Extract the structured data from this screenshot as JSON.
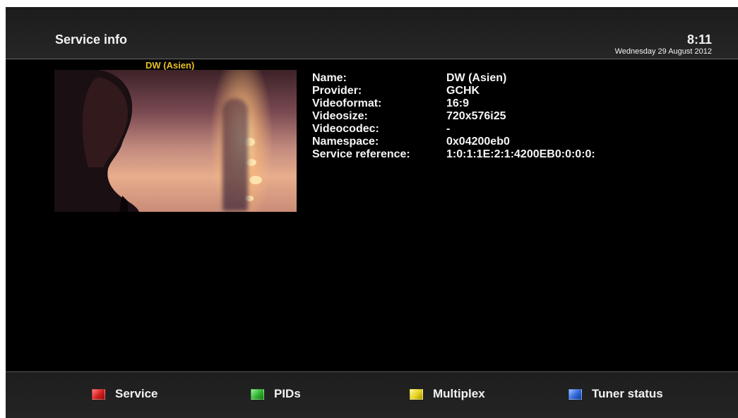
{
  "header": {
    "title": "Service info",
    "time": "8:11",
    "date": "Wednesday 29 August 2012"
  },
  "preview": {
    "channel_label": "DW (Asien)"
  },
  "info": {
    "rows": [
      {
        "key": "Name:",
        "value": "DW (Asien)"
      },
      {
        "key": "Provider:",
        "value": "GCHK"
      },
      {
        "key": "Videoformat:",
        "value": "16:9"
      },
      {
        "key": "Videosize:",
        "value": "720x576i25"
      },
      {
        "key": "Videocodec:",
        "value": "-"
      },
      {
        "key": "Namespace:",
        "value": "0x04200eb0"
      },
      {
        "key": "Service reference:",
        "value": "1:0:1:1E:2:1:4200EB0:0:0:0:"
      }
    ]
  },
  "footer": {
    "buttons": [
      {
        "label": "Service",
        "color": "#d41e1e",
        "icon": "red-key-icon"
      },
      {
        "label": "PIDs",
        "color": "#2fb52f",
        "icon": "green-key-icon"
      },
      {
        "label": "Multiplex",
        "color": "#e6d21e",
        "icon": "yellow-key-icon"
      },
      {
        "label": "Tuner status",
        "color": "#2f67d6",
        "icon": "blue-key-icon"
      }
    ]
  }
}
